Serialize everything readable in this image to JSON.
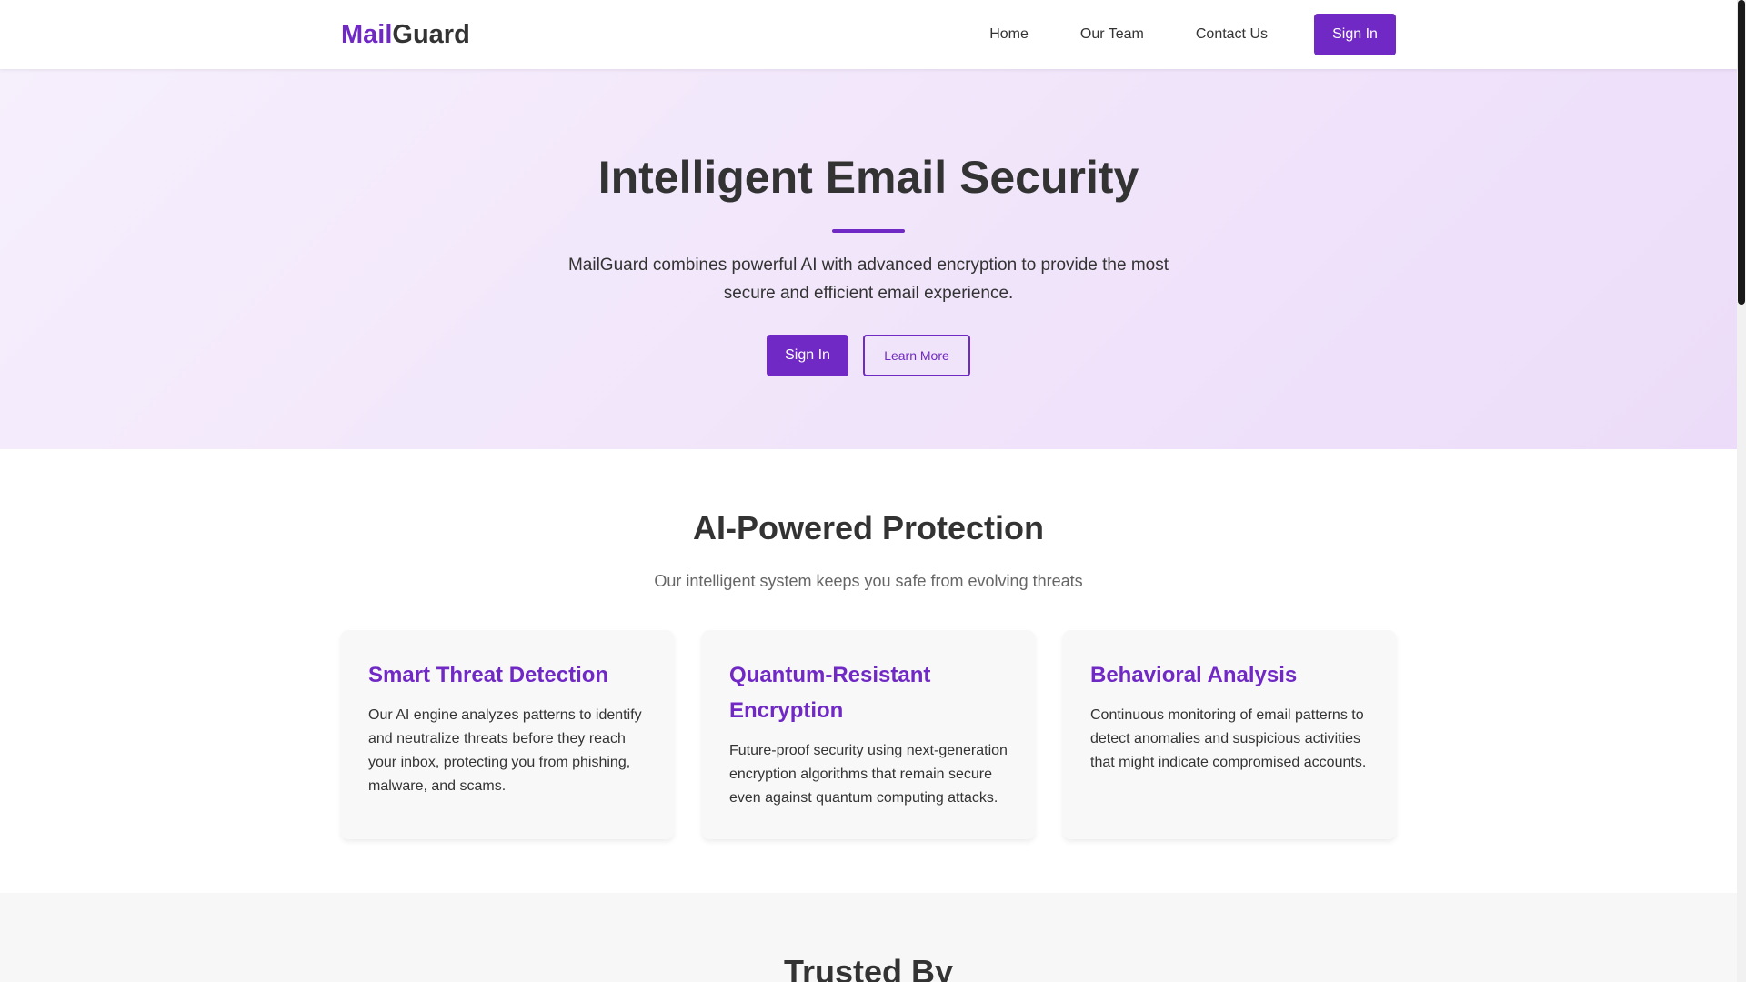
{
  "brand": {
    "accent_part": "Mail",
    "rest_part": "Guard",
    "accent_color": "#7029c4"
  },
  "nav": {
    "links": [
      "Home",
      "Our Team",
      "Contact Us"
    ],
    "sign_in": "Sign In"
  },
  "hero": {
    "title": "Intelligent Email Security",
    "description": "MailGuard combines powerful AI with advanced encryption to provide the most secure and efficient email experience.",
    "primary_button": "Sign In",
    "secondary_button": "Learn More"
  },
  "features": {
    "title": "AI-Powered Protection",
    "subtitle": "Our intelligent system keeps you safe from evolving threats",
    "cards": [
      {
        "title": "Smart Threat Detection",
        "text": "Our AI engine analyzes patterns to identify and neutralize threats before they reach your inbox, protecting you from phishing, malware, and scams."
      },
      {
        "title": "Quantum-Resistant Encryption",
        "text": "Future-proof security using next-generation encryption algorithms that remain secure even against quantum computing attacks."
      },
      {
        "title": "Behavioral Analysis",
        "text": "Continuous monitoring of email patterns to detect anomalies and suspicious activities that might indicate compromised accounts."
      }
    ]
  },
  "trusted": {
    "title": "Trusted By"
  }
}
